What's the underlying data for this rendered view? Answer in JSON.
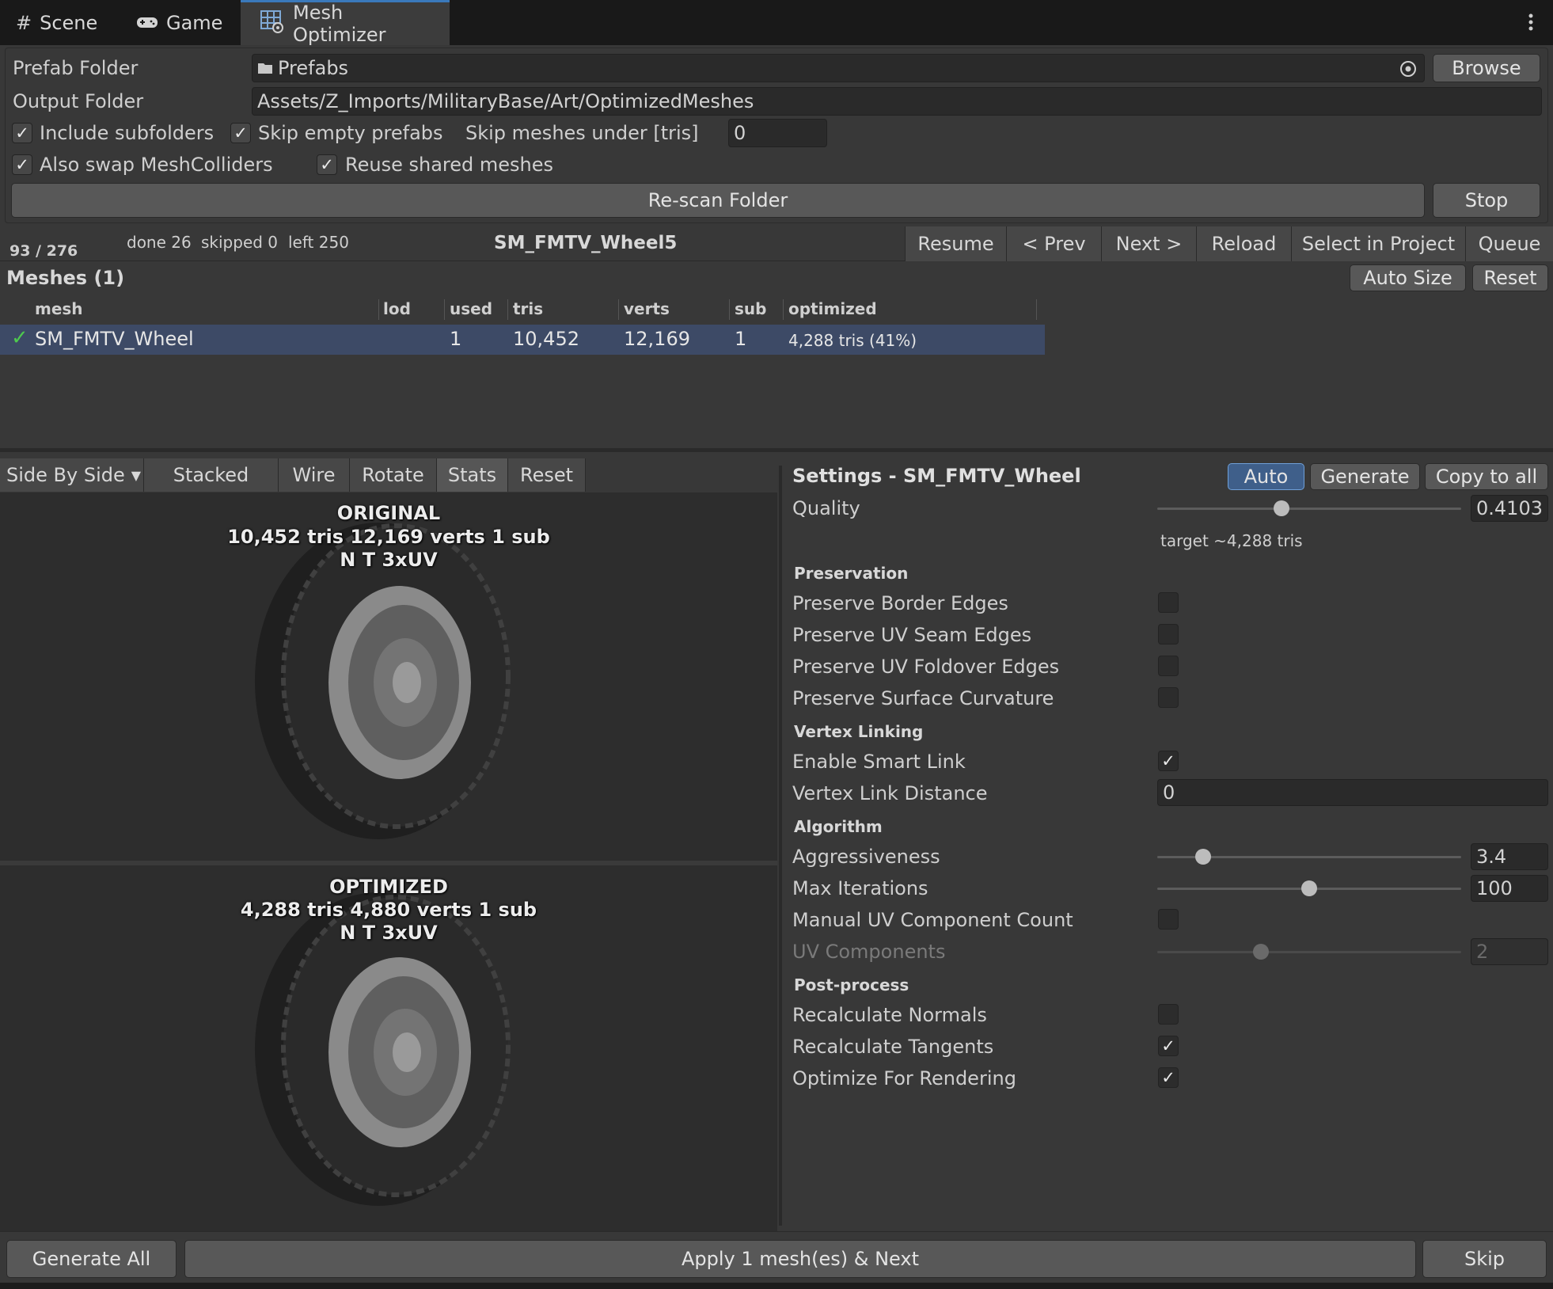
{
  "tabs": [
    {
      "label": "Scene",
      "icon": "grid-icon"
    },
    {
      "label": "Game",
      "icon": "gamepad-icon"
    },
    {
      "label": "Mesh Optimizer",
      "icon": "mesh-optimizer-icon",
      "active": true
    }
  ],
  "folders": {
    "prefab_label": "Prefab Folder",
    "prefab_value": "Prefabs",
    "browse": "Browse",
    "output_label": "Output Folder",
    "output_value": "Assets/Z_Imports/MilitaryBase/Art/OptimizedMeshes"
  },
  "options": {
    "include_subfolders": {
      "label": "Include subfolders",
      "checked": true
    },
    "skip_empty_prefabs": {
      "label": "Skip empty prefabs",
      "checked": true
    },
    "skip_meshes_label": "Skip meshes under [tris]",
    "skip_meshes_value": "0",
    "swap_colliders": {
      "label": "Also swap MeshColliders",
      "checked": true
    },
    "reuse_shared": {
      "label": "Reuse shared meshes",
      "checked": true
    }
  },
  "scan": {
    "rescan": "Re-scan Folder",
    "stop": "Stop"
  },
  "progress": {
    "count": "93 / 276",
    "done": "done 26",
    "skipped": "skipped 0",
    "left": "left 250",
    "current": "SM_FMTV_Wheel5",
    "buttons": [
      "Resume",
      "< Prev",
      "Next >",
      "Reload",
      "Select in Project",
      "Queue"
    ]
  },
  "meshes": {
    "title": "Meshes (1)",
    "auto_size": "Auto Size",
    "reset": "Reset",
    "columns": [
      "mesh",
      "lod",
      "used",
      "tris",
      "verts",
      "sub",
      "optimized"
    ],
    "rows": [
      {
        "mesh": "SM_FMTV_Wheel",
        "lod": "",
        "used": "1",
        "tris": "10,452",
        "verts": "12,169",
        "sub": "1",
        "optimized": "4,288 tris (41%)",
        "status_icon": "check-icon"
      }
    ]
  },
  "viewer": {
    "buttons": [
      "Side By Side",
      "Stacked",
      "Wire",
      "Rotate",
      "Stats",
      "Reset"
    ],
    "original": {
      "title": "ORIGINAL",
      "stats": "10,452 tris   12,169 verts   1 sub",
      "attrs": "N T 3xUV"
    },
    "optimized": {
      "title": "OPTIMIZED",
      "stats": "4,288 tris   4,880 verts   1 sub",
      "attrs": "N T 3xUV"
    }
  },
  "settings": {
    "title": "Settings - SM_FMTV_Wheel",
    "auto": "Auto",
    "generate": "Generate",
    "copy_all": "Copy to all",
    "quality_label": "Quality",
    "quality_value": "0.4103",
    "quality_fraction": 0.41,
    "target": "target ~4,288 tris",
    "sections": {
      "preservation": "Preservation",
      "vertex_linking": "Vertex Linking",
      "algorithm": "Algorithm",
      "post_process": "Post-process"
    },
    "preserve_border": {
      "label": "Preserve Border Edges",
      "checked": false
    },
    "preserve_uv_seam": {
      "label": "Preserve UV Seam Edges",
      "checked": false
    },
    "preserve_uv_foldover": {
      "label": "Preserve UV Foldover Edges",
      "checked": false
    },
    "preserve_curvature": {
      "label": "Preserve Surface Curvature",
      "checked": false
    },
    "smart_link": {
      "label": "Enable Smart Link",
      "checked": true
    },
    "link_distance": {
      "label": "Vertex Link Distance",
      "value": "0"
    },
    "aggressiveness": {
      "label": "Aggressiveness",
      "value": "3.4",
      "fraction": 0.15
    },
    "max_iterations": {
      "label": "Max Iterations",
      "value": "100",
      "fraction": 0.5
    },
    "manual_uv": {
      "label": "Manual UV Component Count",
      "checked": false
    },
    "uv_components": {
      "label": "UV Components",
      "value": "2",
      "fraction": 0.34
    },
    "recalc_normals": {
      "label": "Recalculate Normals",
      "checked": false
    },
    "recalc_tangents": {
      "label": "Recalculate Tangents",
      "checked": true
    },
    "optimize_rendering": {
      "label": "Optimize For Rendering",
      "checked": true
    }
  },
  "footer": {
    "generate_all": "Generate All",
    "apply": "Apply 1 mesh(es) & Next",
    "skip": "Skip"
  },
  "colors": {
    "accent": "#3a79bb",
    "selected_row": "#3d4a66",
    "check_green": "#4ec94e",
    "auto_btn": "#3f5f8a"
  }
}
